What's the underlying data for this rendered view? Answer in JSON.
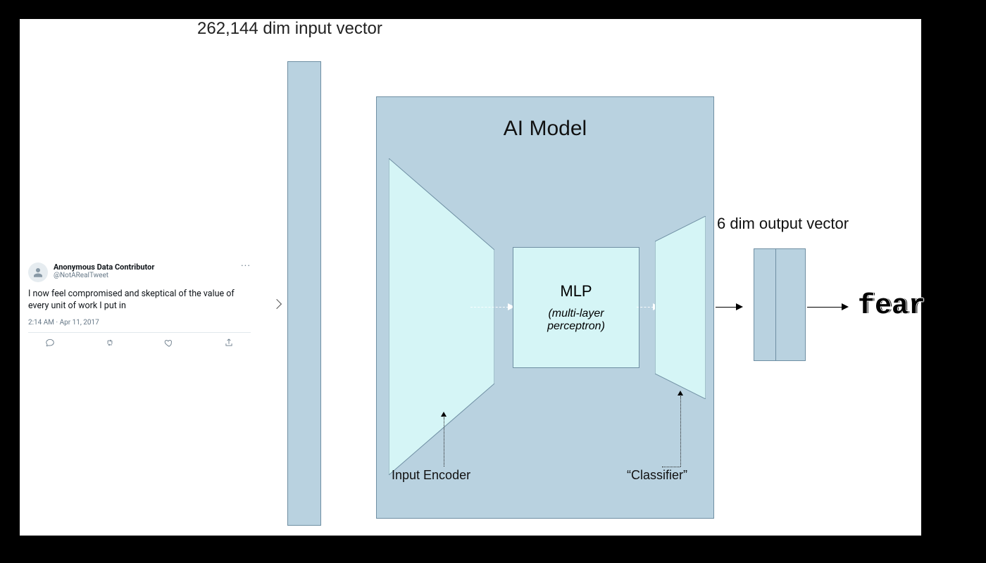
{
  "tweet": {
    "name": "Anonymous Data Contributor",
    "handle": "@NotARealTweet",
    "more": "···",
    "body": "I now feel compromised and skeptical of the value of every unit of work I put in",
    "meta": "2:14 AM · Apr 11, 2017"
  },
  "labels": {
    "input_vector": "262,144 dim input vector",
    "model_title": "AI Model",
    "mlp_title": "MLP",
    "mlp_sub": "(multi-layer perceptron)",
    "encoder": "Input Encoder",
    "classifier": "“Classifier”",
    "output_vector": "6 dim output vector",
    "output_class": "fear"
  }
}
